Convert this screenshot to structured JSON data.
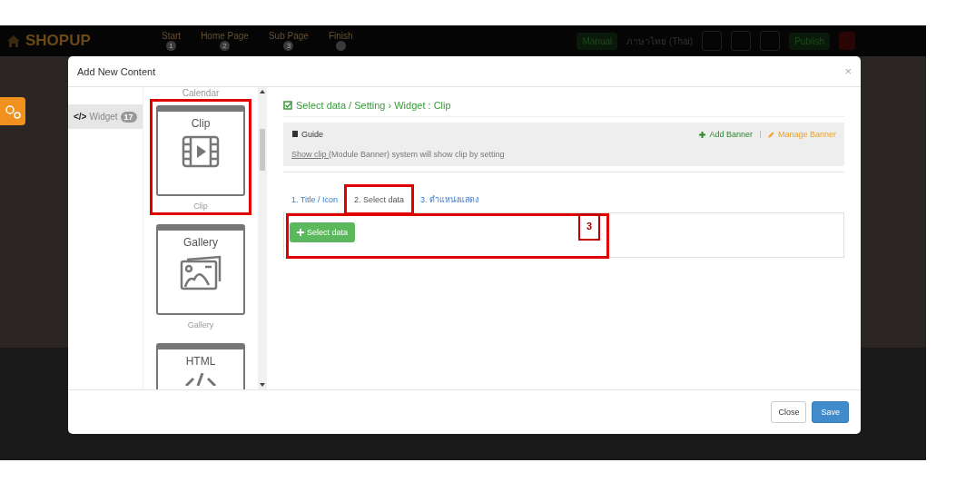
{
  "background_site": {
    "logo": "SHOPUP",
    "steps": [
      {
        "label": "Start",
        "number": "1"
      },
      {
        "label": "Home Page",
        "number": "2"
      },
      {
        "label": "Sub Page",
        "number": "3"
      },
      {
        "label": "Finish"
      }
    ],
    "manual_button": "Manual",
    "language": "ภาษาไทย (Thai)",
    "publish_button": "Publish"
  },
  "modal": {
    "title": "Add New Content",
    "close": "×",
    "nav": [
      {
        "icon_text": "</>",
        "label": "Widget",
        "count": "17",
        "selected": true
      }
    ],
    "widgets_cut_label": "Calendar",
    "widgets": [
      {
        "kind": "clip",
        "title": "Clip",
        "label": "Clip",
        "highlighted": true
      },
      {
        "kind": "gallery",
        "title": "Gallery",
        "label": "Gallery",
        "highlighted": false
      },
      {
        "kind": "html",
        "title": "HTML",
        "highlighted": false
      }
    ],
    "heading": "Select data / Setting › Widget : Clip",
    "guide": {
      "title": "Guide",
      "add_link": "Add Banner",
      "manage_link": "Manage Banner",
      "text_link": "Show clip ",
      "text": "(Module Banner) system will show clip by setting"
    },
    "tabs": [
      {
        "label": "1. Title / Icon",
        "selected": false,
        "highlighted": false
      },
      {
        "label": "2. Select data",
        "selected": true,
        "highlighted": true
      },
      {
        "label": "3. ตำแหน่งแสดง",
        "selected": false,
        "highlighted": false
      }
    ],
    "panel": {
      "button": "Select data",
      "annotation": "3"
    },
    "footer": {
      "close": "Close",
      "save": "Save"
    }
  }
}
